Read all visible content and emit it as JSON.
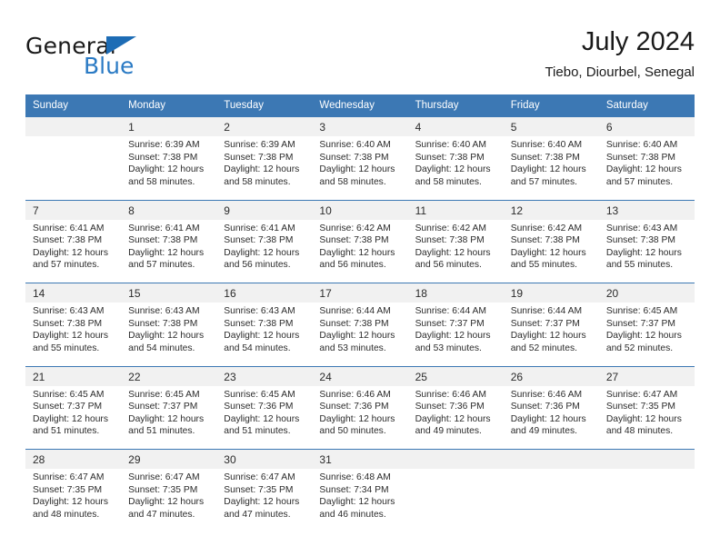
{
  "brand": {
    "name_part1": "General",
    "name_part2": "Blue",
    "triangle_icon": "triangle-icon",
    "colors": {
      "dark": "#1a1a1a",
      "blue": "#2a7ac4",
      "triangle": "#1d6cb5"
    }
  },
  "header": {
    "title": "July 2024",
    "subtitle": "Tiebo, Diourbel, Senegal"
  },
  "theme": {
    "header_bg": "#3c78b4",
    "header_text": "#ffffff",
    "daynum_bg": "#f1f1f1",
    "cell_bg": "#ffffff",
    "body_text": "#2b2b2b"
  },
  "calendar": {
    "weekday_headers": [
      "Sunday",
      "Monday",
      "Tuesday",
      "Wednesday",
      "Thursday",
      "Friday",
      "Saturday"
    ],
    "weeks": [
      {
        "days": [
          {
            "num": "",
            "lines": []
          },
          {
            "num": "1",
            "lines": [
              "Sunrise: 6:39 AM",
              "Sunset: 7:38 PM",
              "Daylight: 12 hours",
              "and 58 minutes."
            ]
          },
          {
            "num": "2",
            "lines": [
              "Sunrise: 6:39 AM",
              "Sunset: 7:38 PM",
              "Daylight: 12 hours",
              "and 58 minutes."
            ]
          },
          {
            "num": "3",
            "lines": [
              "Sunrise: 6:40 AM",
              "Sunset: 7:38 PM",
              "Daylight: 12 hours",
              "and 58 minutes."
            ]
          },
          {
            "num": "4",
            "lines": [
              "Sunrise: 6:40 AM",
              "Sunset: 7:38 PM",
              "Daylight: 12 hours",
              "and 58 minutes."
            ]
          },
          {
            "num": "5",
            "lines": [
              "Sunrise: 6:40 AM",
              "Sunset: 7:38 PM",
              "Daylight: 12 hours",
              "and 57 minutes."
            ]
          },
          {
            "num": "6",
            "lines": [
              "Sunrise: 6:40 AM",
              "Sunset: 7:38 PM",
              "Daylight: 12 hours",
              "and 57 minutes."
            ]
          }
        ]
      },
      {
        "days": [
          {
            "num": "7",
            "lines": [
              "Sunrise: 6:41 AM",
              "Sunset: 7:38 PM",
              "Daylight: 12 hours",
              "and 57 minutes."
            ]
          },
          {
            "num": "8",
            "lines": [
              "Sunrise: 6:41 AM",
              "Sunset: 7:38 PM",
              "Daylight: 12 hours",
              "and 57 minutes."
            ]
          },
          {
            "num": "9",
            "lines": [
              "Sunrise: 6:41 AM",
              "Sunset: 7:38 PM",
              "Daylight: 12 hours",
              "and 56 minutes."
            ]
          },
          {
            "num": "10",
            "lines": [
              "Sunrise: 6:42 AM",
              "Sunset: 7:38 PM",
              "Daylight: 12 hours",
              "and 56 minutes."
            ]
          },
          {
            "num": "11",
            "lines": [
              "Sunrise: 6:42 AM",
              "Sunset: 7:38 PM",
              "Daylight: 12 hours",
              "and 56 minutes."
            ]
          },
          {
            "num": "12",
            "lines": [
              "Sunrise: 6:42 AM",
              "Sunset: 7:38 PM",
              "Daylight: 12 hours",
              "and 55 minutes."
            ]
          },
          {
            "num": "13",
            "lines": [
              "Sunrise: 6:43 AM",
              "Sunset: 7:38 PM",
              "Daylight: 12 hours",
              "and 55 minutes."
            ]
          }
        ]
      },
      {
        "days": [
          {
            "num": "14",
            "lines": [
              "Sunrise: 6:43 AM",
              "Sunset: 7:38 PM",
              "Daylight: 12 hours",
              "and 55 minutes."
            ]
          },
          {
            "num": "15",
            "lines": [
              "Sunrise: 6:43 AM",
              "Sunset: 7:38 PM",
              "Daylight: 12 hours",
              "and 54 minutes."
            ]
          },
          {
            "num": "16",
            "lines": [
              "Sunrise: 6:43 AM",
              "Sunset: 7:38 PM",
              "Daylight: 12 hours",
              "and 54 minutes."
            ]
          },
          {
            "num": "17",
            "lines": [
              "Sunrise: 6:44 AM",
              "Sunset: 7:38 PM",
              "Daylight: 12 hours",
              "and 53 minutes."
            ]
          },
          {
            "num": "18",
            "lines": [
              "Sunrise: 6:44 AM",
              "Sunset: 7:37 PM",
              "Daylight: 12 hours",
              "and 53 minutes."
            ]
          },
          {
            "num": "19",
            "lines": [
              "Sunrise: 6:44 AM",
              "Sunset: 7:37 PM",
              "Daylight: 12 hours",
              "and 52 minutes."
            ]
          },
          {
            "num": "20",
            "lines": [
              "Sunrise: 6:45 AM",
              "Sunset: 7:37 PM",
              "Daylight: 12 hours",
              "and 52 minutes."
            ]
          }
        ]
      },
      {
        "days": [
          {
            "num": "21",
            "lines": [
              "Sunrise: 6:45 AM",
              "Sunset: 7:37 PM",
              "Daylight: 12 hours",
              "and 51 minutes."
            ]
          },
          {
            "num": "22",
            "lines": [
              "Sunrise: 6:45 AM",
              "Sunset: 7:37 PM",
              "Daylight: 12 hours",
              "and 51 minutes."
            ]
          },
          {
            "num": "23",
            "lines": [
              "Sunrise: 6:45 AM",
              "Sunset: 7:36 PM",
              "Daylight: 12 hours",
              "and 51 minutes."
            ]
          },
          {
            "num": "24",
            "lines": [
              "Sunrise: 6:46 AM",
              "Sunset: 7:36 PM",
              "Daylight: 12 hours",
              "and 50 minutes."
            ]
          },
          {
            "num": "25",
            "lines": [
              "Sunrise: 6:46 AM",
              "Sunset: 7:36 PM",
              "Daylight: 12 hours",
              "and 49 minutes."
            ]
          },
          {
            "num": "26",
            "lines": [
              "Sunrise: 6:46 AM",
              "Sunset: 7:36 PM",
              "Daylight: 12 hours",
              "and 49 minutes."
            ]
          },
          {
            "num": "27",
            "lines": [
              "Sunrise: 6:47 AM",
              "Sunset: 7:35 PM",
              "Daylight: 12 hours",
              "and 48 minutes."
            ]
          }
        ]
      },
      {
        "days": [
          {
            "num": "28",
            "lines": [
              "Sunrise: 6:47 AM",
              "Sunset: 7:35 PM",
              "Daylight: 12 hours",
              "and 48 minutes."
            ]
          },
          {
            "num": "29",
            "lines": [
              "Sunrise: 6:47 AM",
              "Sunset: 7:35 PM",
              "Daylight: 12 hours",
              "and 47 minutes."
            ]
          },
          {
            "num": "30",
            "lines": [
              "Sunrise: 6:47 AM",
              "Sunset: 7:35 PM",
              "Daylight: 12 hours",
              "and 47 minutes."
            ]
          },
          {
            "num": "31",
            "lines": [
              "Sunrise: 6:48 AM",
              "Sunset: 7:34 PM",
              "Daylight: 12 hours",
              "and 46 minutes."
            ]
          },
          {
            "num": "",
            "lines": []
          },
          {
            "num": "",
            "lines": []
          },
          {
            "num": "",
            "lines": []
          }
        ]
      }
    ]
  }
}
